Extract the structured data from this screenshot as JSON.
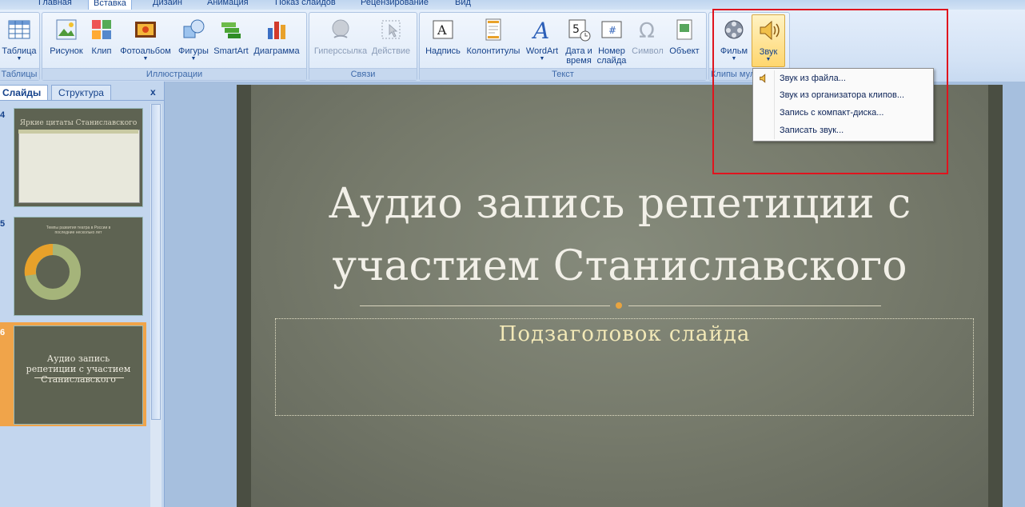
{
  "ribbon": {
    "tabs": [
      "Главная",
      "Вставка",
      "Дизайн",
      "Анимация",
      "Показ слайдов",
      "Рецензирование",
      "Вид"
    ],
    "groups": {
      "tables": {
        "label": "Таблицы",
        "buttons": [
          {
            "label": "Таблица",
            "icon": "table-icon"
          }
        ]
      },
      "illustrations": {
        "label": "Иллюстрации",
        "buttons": [
          {
            "label": "Рисунок",
            "icon": "picture-icon"
          },
          {
            "label": "Клип",
            "icon": "clip-icon"
          },
          {
            "label": "Фотоальбом",
            "icon": "photo-album-icon"
          },
          {
            "label": "Фигуры",
            "icon": "shapes-icon"
          },
          {
            "label": "SmartArt",
            "icon": "smartart-icon"
          },
          {
            "label": "Диаграмма",
            "icon": "chart-icon"
          }
        ]
      },
      "links": {
        "label": "Связи",
        "buttons": [
          {
            "label": "Гиперссылка",
            "icon": "hyperlink-icon"
          },
          {
            "label": "Действие",
            "icon": "action-icon"
          }
        ]
      },
      "text": {
        "label": "Текст",
        "buttons": [
          {
            "label": "Надпись",
            "icon": "textbox-icon"
          },
          {
            "label": "Колонтитулы",
            "icon": "header-footer-icon"
          },
          {
            "label": "WordArt",
            "icon": "wordart-icon"
          },
          {
            "label": "Дата и",
            "label2": "время",
            "icon": "date-time-icon"
          },
          {
            "label": "Номер",
            "label2": "слайда",
            "icon": "slide-number-icon"
          },
          {
            "label": "Символ",
            "icon": "symbol-icon"
          },
          {
            "label": "Объект",
            "icon": "object-icon"
          }
        ]
      },
      "media": {
        "label": "Клипы мул",
        "buttons": [
          {
            "label": "Фильм",
            "icon": "film-icon"
          },
          {
            "label": "Звук",
            "icon": "sound-icon"
          }
        ]
      }
    }
  },
  "pane": {
    "tabs": [
      "Слайды",
      "Структура"
    ],
    "close": "x",
    "thumbs": [
      {
        "num": "4",
        "title": "Яркие цитаты Станиславского"
      },
      {
        "num": "5",
        "title": "Темпы развития театра в России в последние несколько лет"
      },
      {
        "num": "6",
        "title": "Аудио запись репетиции с участием Станиславского"
      }
    ]
  },
  "slide": {
    "title": "Аудио запись репетиции с участием Станиславского",
    "subtitle": "Подзаголовок слайда"
  },
  "menu": {
    "items": [
      "Звук из файла...",
      "Звук из организатора клипов...",
      "Запись с компакт-диска...",
      "Записать звук..."
    ]
  },
  "colors": {
    "highlight": "#e0141e",
    "slide_bg": "#767a6b",
    "subtitle": "#f3e9b7"
  }
}
